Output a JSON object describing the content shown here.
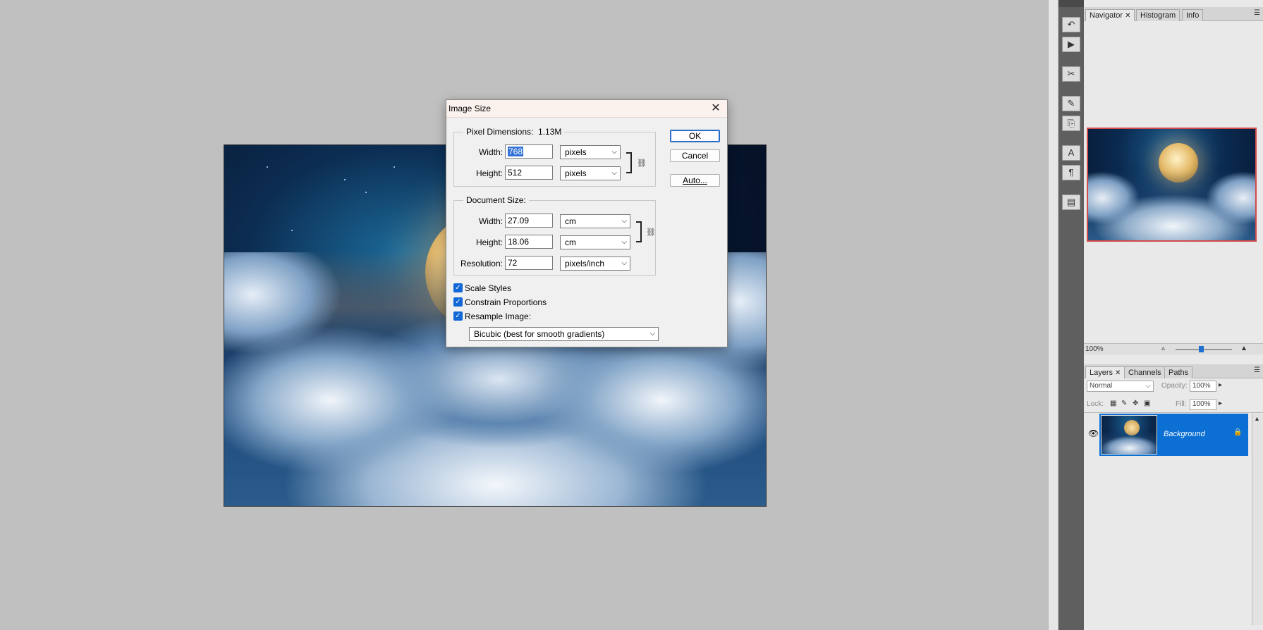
{
  "dialog": {
    "title": "Image Size",
    "pixel_dimensions": {
      "legend": "Pixel Dimensions:",
      "size": "1.13M",
      "width_label": "Width:",
      "width_value": "768",
      "width_unit": "pixels",
      "height_label": "Height:",
      "height_value": "512",
      "height_unit": "pixels"
    },
    "document_size": {
      "legend": "Document Size:",
      "width_label": "Width:",
      "width_value": "27.09",
      "width_unit": "cm",
      "height_label": "Height:",
      "height_value": "18.06",
      "height_unit": "cm",
      "resolution_label": "Resolution:",
      "resolution_value": "72",
      "resolution_unit": "pixels/inch"
    },
    "options": {
      "scale_styles": "Scale Styles",
      "constrain_proportions": "Constrain Proportions",
      "resample_image": "Resample Image:",
      "resample_method": "Bicubic (best for smooth gradients)"
    },
    "buttons": {
      "ok": "OK",
      "cancel": "Cancel",
      "auto": "Auto..."
    }
  },
  "navigator_panel": {
    "tabs": [
      "Navigator",
      "Histogram",
      "Info"
    ],
    "zoom": "100%"
  },
  "layers_panel": {
    "tabs": [
      "Layers",
      "Channels",
      "Paths"
    ],
    "blend_mode": "Normal",
    "opacity_label": "Opacity:",
    "opacity_value": "100%",
    "lock_label": "Lock:",
    "fill_label": "Fill:",
    "fill_value": "100%",
    "layers": [
      {
        "name": "Background"
      }
    ]
  },
  "colors": {
    "workspace": "#c0c0c0",
    "selection_blue": "#0b6fd3",
    "navigator_frame": "#d24a4a"
  }
}
